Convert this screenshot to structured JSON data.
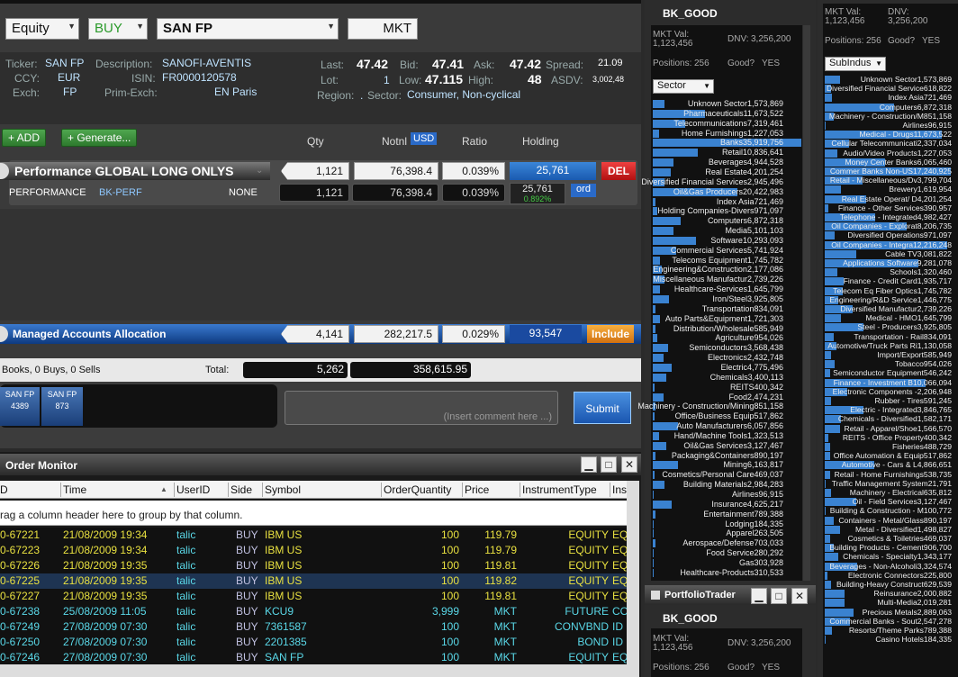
{
  "top": {
    "asset": "Equity",
    "side": "BUY",
    "symbol": "SAN FP",
    "ordtype": "MKT"
  },
  "info": {
    "ticker_l": "Ticker:",
    "ticker": "SAN FP",
    "desc_l": "Description:",
    "desc": "SANOFI-AVENTIS",
    "ccy_l": "CCY:",
    "ccy": "EUR",
    "isin_l": "ISIN:",
    "isin": "FR0000120578",
    "exch_l": "Exch:",
    "exch": "FP",
    "prim_l": "Prim-Exch:",
    "prim": "EN Paris",
    "last_l": "Last:",
    "last": "47.42",
    "bid_l": "Bid:",
    "bid": "47.41",
    "ask_l": "Ask:",
    "ask": "47.42",
    "spread_l": "Spread:",
    "spread": "21.09",
    "lot_l": "Lot:",
    "lot": "1",
    "low_l": "Low:",
    "low": "47.115",
    "high_l": "High:",
    "high": "48",
    "asdv_l": "ASDV:",
    "asdv": "3,002,48",
    "region_l": "Region:",
    "region": ".",
    "sector_l": "Sector:",
    "sector": "Consumer, Non-cyclical"
  },
  "alloc": {
    "add": "+ ADD",
    "generate": "+ Generate...",
    "qty_h": "Qty",
    "notnl_h": "Notnl",
    "usd": "USD",
    "ratio_h": "Ratio",
    "holding_h": "Holding",
    "perf_title": "Performance GLOBAL LONG ONLYS",
    "perf_qty": "1,121",
    "perf_notnl": "76,398.4",
    "perf_ratio": "0.039%",
    "perf_holding": "25,761",
    "del": "DEL",
    "sub_name": "PERFORMANCE",
    "sub_code": "BK-PERF",
    "sub_none": "NONE",
    "sub_qty": "1,121",
    "sub_notnl": "76,398.4",
    "sub_ratio": "0.039%",
    "sub_holding": "25,761",
    "sub_pct": "0.892%",
    "ord": "ord",
    "mgd_title": "Managed Accounts Allocation",
    "mgd_qty": "4,141",
    "mgd_notnl": "282,217.5",
    "mgd_ratio": "0.029%",
    "mgd_holding": "93,547",
    "include": "Include",
    "summary": "Books, 0 Buys, 0 Sells",
    "total_l": "Total:",
    "total_qty": "5,262",
    "total_notnl": "358,615.95",
    "tile1_sym": "SAN FP",
    "tile1_val": "4389",
    "tile2_sym": "SAN FP",
    "tile2_val": "873",
    "comment_ph": "(Insert comment here ...)",
    "submit": "Submit"
  },
  "monitor": {
    "title": "Order Monitor",
    "cols": [
      "D",
      "Time",
      "UserID",
      "Side",
      "Symbol",
      "OrderQuantity",
      "Price",
      "InstrumentType",
      "Ins"
    ],
    "group_hint": "rag a column header here to group by that column.",
    "rows": [
      [
        "0-67221",
        "21/08/2009 19:34",
        "talic",
        "BUY",
        "IBM US",
        "100",
        "119.79",
        "EQUITY",
        "EQ"
      ],
      [
        "0-67223",
        "21/08/2009 19:34",
        "talic",
        "BUY",
        "IBM US",
        "100",
        "119.79",
        "EQUITY",
        "EQ"
      ],
      [
        "0-67226",
        "21/08/2009 19:35",
        "talic",
        "BUY",
        "IBM US",
        "100",
        "119.81",
        "EQUITY",
        "EQ"
      ],
      [
        "0-67225",
        "21/08/2009 19:35",
        "talic",
        "BUY",
        "IBM US",
        "100",
        "119.82",
        "EQUITY",
        "EQ"
      ],
      [
        "0-67227",
        "21/08/2009 19:35",
        "talic",
        "BUY",
        "IBM US",
        "100",
        "119.81",
        "EQUITY",
        "EQ"
      ],
      [
        "0-67238",
        "25/08/2009 11:05",
        "talic",
        "BUY",
        "KCU9",
        "3,999",
        "MKT",
        "FUTURE",
        "CO"
      ],
      [
        "0-67249",
        "27/08/2009 07:30",
        "talic",
        "BUY",
        "7361587",
        "100",
        "MKT",
        "CONVBND",
        "ID"
      ],
      [
        "0-67250",
        "27/08/2009 07:30",
        "talic",
        "BUY",
        "2201385",
        "100",
        "MKT",
        "BOND",
        "ID"
      ],
      [
        "0-67246",
        "27/08/2009 07:30",
        "talic",
        "BUY",
        "SAN FP",
        "100",
        "MKT",
        "EQUITY",
        "EQ"
      ]
    ]
  },
  "bk1": {
    "title": "BK_GOOD",
    "mktval_l": "MKT Val:",
    "mktval": "1,123,456",
    "dnv_l": "DNV:",
    "dnv": "3,256,200",
    "pos_l": "Positions:",
    "pos": "256",
    "good_l": "Good?",
    "good": "YES",
    "dropdown": "Sector",
    "items": [
      [
        "Unknown Sector",
        "1,573,869",
        0.08
      ],
      [
        "Pharmaceuticals",
        "11,673,522",
        0.35
      ],
      [
        "Telecommunications",
        "7,319,461",
        0.22
      ],
      [
        "Home Furnishings",
        "1,227,053",
        0.04
      ],
      [
        "Banks",
        "35,919,756",
        1.0
      ],
      [
        "Retail",
        "10,836,641",
        0.3
      ],
      [
        "Beverages",
        "4,944,528",
        0.14
      ],
      [
        "Real Estate",
        "4,201,254",
        0.12
      ],
      [
        "Diversified Financial Services",
        "2,945,496",
        0.08
      ],
      [
        "Oil&Gas Producers",
        "20,422,983",
        0.57
      ],
      [
        "Index Asia",
        "721,469",
        0.02
      ],
      [
        "Holding Companies-Divers",
        "971,097",
        0.03
      ],
      [
        "Computers",
        "6,872,318",
        0.19
      ],
      [
        "Media",
        "5,101,103",
        0.14
      ],
      [
        "Software",
        "10,293,093",
        0.29
      ],
      [
        "Commercial Services",
        "5,741,924",
        0.16
      ],
      [
        "Telecoms Equipment",
        "1,745,782",
        0.05
      ],
      [
        "Engineering&Construction",
        "2,177,086",
        0.06
      ],
      [
        "Miscellaneous Manufactur",
        "2,739,226",
        0.08
      ],
      [
        "Healthcare-Services",
        "1,645,799",
        0.05
      ],
      [
        "Iron/Steel",
        "3,925,805",
        0.11
      ],
      [
        "Transportation",
        "834,091",
        0.02
      ],
      [
        "Auto Parts&Equipment",
        "1,721,303",
        0.05
      ],
      [
        "Distribution/Wholesale",
        "585,949",
        0.02
      ],
      [
        "Agriculture",
        "954,026",
        0.03
      ],
      [
        "Semiconductors",
        "3,568,438",
        0.1
      ],
      [
        "Electronics",
        "2,432,748",
        0.07
      ],
      [
        "Electric",
        "4,775,496",
        0.13
      ],
      [
        "Chemicals",
        "3,400,113",
        0.09
      ],
      [
        "REITS",
        "400,342",
        0.01
      ],
      [
        "Food",
        "2,474,231",
        0.07
      ],
      [
        "Machinery - Construction/Mining",
        "851,158",
        0.02
      ],
      [
        "Office/Business Equip",
        "517,862",
        0.01
      ],
      [
        "Auto Manufacturers",
        "6,057,856",
        0.17
      ],
      [
        "Hand/Machine Tools",
        "1,323,513",
        0.04
      ],
      [
        "Oil&Gas Services",
        "3,127,467",
        0.09
      ],
      [
        "Packaging&Containers",
        "890,197",
        0.02
      ],
      [
        "Mining",
        "6,163,817",
        0.17
      ],
      [
        "Cosmetics/Personal Care",
        "469,037",
        0.01
      ],
      [
        "Building Materials",
        "2,984,283",
        0.08
      ],
      [
        "Airlines",
        "96,915",
        0.003
      ],
      [
        "Insurance",
        "4,625,217",
        0.13
      ],
      [
        "Entertainment",
        "789,388",
        0.02
      ],
      [
        "Lodging",
        "184,335",
        0.005
      ],
      [
        "Apparel",
        "263,505",
        0.007
      ],
      [
        "Aerospace/Defense",
        "703,033",
        0.02
      ],
      [
        "Food Service",
        "280,292",
        0.008
      ],
      [
        "Gas",
        "303,928",
        0.008
      ],
      [
        "Healthcare-Products",
        "310,533",
        0.009
      ]
    ]
  },
  "pt": {
    "title": "PortfolioTrader",
    "bk_title": "BK_GOOD",
    "mktval_l": "MKT Val:",
    "mktval": "1,123,456",
    "dnv_l": "DNV:",
    "dnv": "3,256,200",
    "pos_l": "Positions:",
    "pos": "256",
    "good_l": "Good?",
    "good": "YES"
  },
  "bk2": {
    "mktval_l": "MKT Val:",
    "mktval": "1,123,456",
    "dnv_l": "DNV:",
    "dnv": "3,256,200",
    "pos_l": "Positions:",
    "pos": "256",
    "good_l": "Good?",
    "good": "YES",
    "dropdown": "SubIndus",
    "items": [
      [
        "Unknown Sector",
        "1,573,869",
        0.12
      ],
      [
        "Diversified Financial Service",
        "618,822",
        0.05
      ],
      [
        "Index Asia",
        "721,469",
        0.06
      ],
      [
        "Computers",
        "6,872,318",
        0.55
      ],
      [
        "Machinery - Construction/M",
        "851,158",
        0.07
      ],
      [
        "Airlines",
        "96,915",
        0.01
      ],
      [
        "Medical - Drugs",
        "11,673,522",
        0.93
      ],
      [
        "Cellular Telecommunicati",
        "2,337,034",
        0.19
      ],
      [
        "Audio/Video Products",
        "1,227,053",
        0.1
      ],
      [
        "Money Center Banks",
        "6,065,460",
        0.48
      ],
      [
        "Commer Banks Non-US",
        "17,240,925",
        1.0
      ],
      [
        "Retail - Miscellaneous/Dv",
        "3,799,704",
        0.3
      ],
      [
        "Brewery",
        "1,619,954",
        0.13
      ],
      [
        "Real Estate Operat/ D",
        "4,201,254",
        0.33
      ],
      [
        "Finance - Other Services",
        "390,957",
        0.03
      ],
      [
        "Telephone - Integrated",
        "4,982,427",
        0.4
      ],
      [
        "Oil Companies - Explorat",
        "8,206,735",
        0.65
      ],
      [
        "Diversified Operations",
        "971,097",
        0.08
      ],
      [
        "Oil Companies - Integra",
        "12,216,248",
        0.97
      ],
      [
        "Cable TV",
        "3,081,822",
        0.25
      ],
      [
        "Applications Software",
        "9,281,078",
        0.74
      ],
      [
        "Schools",
        "1,320,460",
        0.1
      ],
      [
        "Finance - Credit Card",
        "1,935,717",
        0.15
      ],
      [
        "Telecom Eq Fiber Optics",
        "1,745,782",
        0.14
      ],
      [
        "Engineering/R&D Service",
        "1,446,775",
        0.11
      ],
      [
        "Diversified Manufactur",
        "2,739,226",
        0.22
      ],
      [
        "Medical - HMO",
        "1,645,799",
        0.13
      ],
      [
        "Steel - Producers",
        "3,925,805",
        0.31
      ],
      [
        "Transportation - Rail",
        "834,091",
        0.07
      ],
      [
        "Automotive/Truck Parts Ri",
        "1,130,058",
        0.09
      ],
      [
        "Import/Export",
        "585,949",
        0.05
      ],
      [
        "Tobacco",
        "954,026",
        0.08
      ],
      [
        "Semiconductor Equipment",
        "546,242",
        0.04
      ],
      [
        "Finance - Investment B",
        "10,066,094",
        0.8
      ],
      [
        "Electronic Components -",
        "2,206,948",
        0.18
      ],
      [
        "Rubber - Tires",
        "591,245",
        0.05
      ],
      [
        "Electric - Integrated",
        "3,846,765",
        0.31
      ],
      [
        "Chemicals - Diversified",
        "1,582,171",
        0.13
      ],
      [
        "Retail - Apparel/Shoe",
        "1,566,570",
        0.12
      ],
      [
        "REITS - Office Property",
        "400,342",
        0.03
      ],
      [
        "Fisheries",
        "488,729",
        0.04
      ],
      [
        "Office Automation & Equip",
        "517,862",
        0.04
      ],
      [
        "Automotive - Cars & L",
        "4,866,651",
        0.39
      ],
      [
        "Retail - Home Furnishings",
        "538,735",
        0.04
      ],
      [
        "Traffic Management System",
        "21,791",
        0.01
      ],
      [
        "Machinery - Electrical",
        "635,812",
        0.05
      ],
      [
        "Oil - Field Services",
        "3,127,467",
        0.25
      ],
      [
        "Building & Construction - M",
        "100,772",
        0.01
      ],
      [
        "Containers - Metal/Glass",
        "890,197",
        0.07
      ],
      [
        "Metal - Diversified",
        "1,498,827",
        0.12
      ],
      [
        "Cosmetics & Toiletries",
        "469,037",
        0.04
      ],
      [
        "Building Products - Cement",
        "906,700",
        0.07
      ],
      [
        "Chemicals - Specialty",
        "1,343,177",
        0.11
      ],
      [
        "Beverages - Non-Alcoholi",
        "3,324,574",
        0.26
      ],
      [
        "Electronic Connectors",
        "225,800",
        0.02
      ],
      [
        "Building-Heavy Construct",
        "629,539",
        0.05
      ],
      [
        "Reinsurance",
        "2,000,882",
        0.16
      ],
      [
        "Multi-Media",
        "2,019,281",
        0.16
      ],
      [
        "Precious Metals",
        "2,889,063",
        0.23
      ],
      [
        "Commercial Banks - Sout",
        "2,547,278",
        0.2
      ],
      [
        "Resorts/Theme Parks",
        "789,388",
        0.06
      ],
      [
        "Casino Hotels",
        "184,335",
        0.01
      ]
    ]
  }
}
